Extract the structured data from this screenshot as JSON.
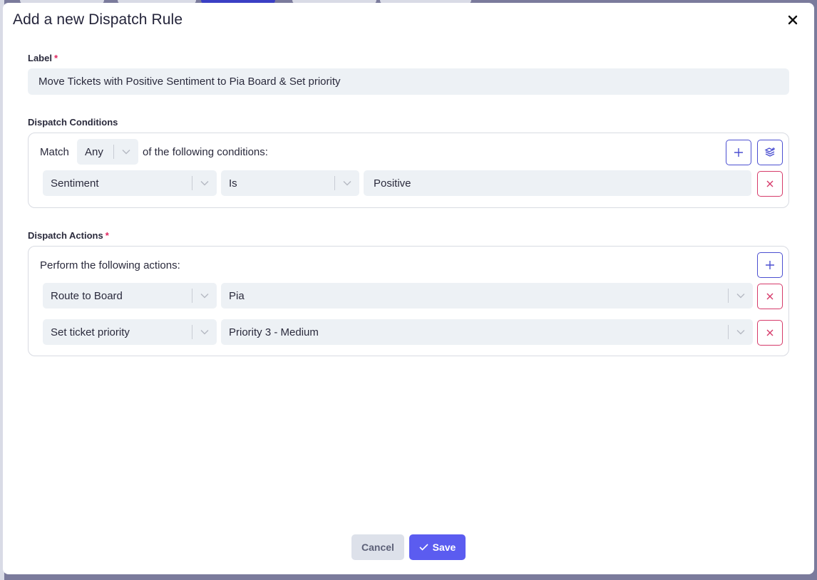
{
  "modal": {
    "title": "Add a new Dispatch Rule"
  },
  "label_field": {
    "label": "Label",
    "required_mark": "*",
    "value": "Move Tickets with Positive Sentiment to Pia Board & Set priority"
  },
  "conditions": {
    "heading": "Dispatch Conditions",
    "match_prefix": "Match",
    "match_value": "Any",
    "match_suffix": "of the following conditions:",
    "rows": [
      {
        "field": "Sentiment",
        "operator": "Is",
        "value": "Positive"
      }
    ]
  },
  "actions": {
    "heading": "Dispatch Actions",
    "required_mark": "*",
    "intro": "Perform the following actions:",
    "rows": [
      {
        "action": "Route to Board",
        "value": "Pia"
      },
      {
        "action": "Set ticket priority",
        "value": "Priority 3 - Medium"
      }
    ]
  },
  "footer": {
    "cancel_label": "Cancel",
    "save_label": "Save"
  },
  "icons": {
    "close": "close-icon",
    "add": "plus-icon",
    "group": "layers-icon",
    "remove": "x-icon",
    "chevron": "chevron-down-icon",
    "check": "check-icon"
  },
  "colors": {
    "accent": "#5b5cf0",
    "outline_blue": "#4b4fd1",
    "danger": "#d63a6a",
    "field_bg": "#edf1f5"
  }
}
